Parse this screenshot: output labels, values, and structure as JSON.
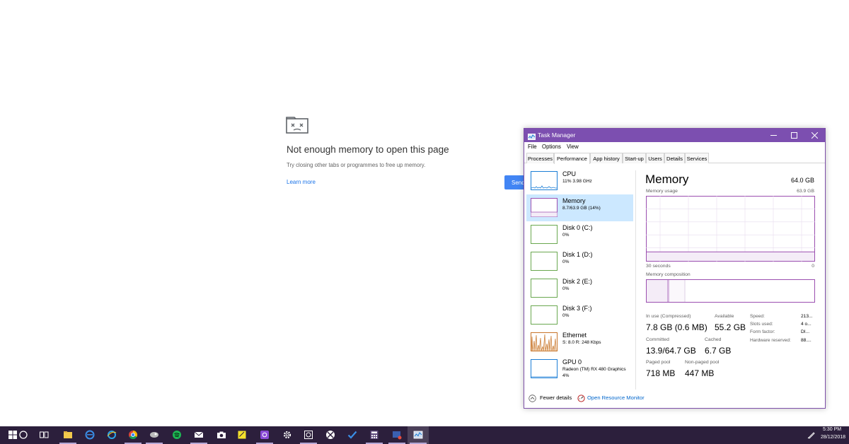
{
  "chrome_error": {
    "title": "Not enough memory to open this page",
    "subtitle": "Try closing other tabs or programmes to free up memory.",
    "link": "Learn more",
    "send_button": "Send"
  },
  "task_manager": {
    "title": "Task Manager",
    "accent_color": "#7c4fb0",
    "menu": [
      "File",
      "Options",
      "View"
    ],
    "tabs": [
      "Processes",
      "Performance",
      "App history",
      "Start-up",
      "Users",
      "Details",
      "Services"
    ],
    "active_tab": "Performance",
    "resources": [
      {
        "name": "CPU",
        "sub": "11%  3.98 GHz",
        "sub2": "",
        "color": "#1c7ed6"
      },
      {
        "name": "Memory",
        "sub": "8.7/63.9 GB (14%)",
        "sub2": "",
        "color": "#9b4fb0",
        "selected": true
      },
      {
        "name": "Disk 0 (C:)",
        "sub": "0%",
        "sub2": "",
        "color": "#6aa84f"
      },
      {
        "name": "Disk 1 (D:)",
        "sub": "0%",
        "sub2": "",
        "color": "#6aa84f"
      },
      {
        "name": "Disk 2 (E:)",
        "sub": "0%",
        "sub2": "",
        "color": "#6aa84f"
      },
      {
        "name": "Disk 3 (F:)",
        "sub": "0%",
        "sub2": "",
        "color": "#6aa84f"
      },
      {
        "name": "Ethernet",
        "sub": "S: 8.0  R: 248 Kbps",
        "sub2": "",
        "color": "#c8752a"
      },
      {
        "name": "GPU 0",
        "sub": "Radeon (TM) RX 480 Graphics",
        "sub2": "4%",
        "color": "#1c7ed6"
      }
    ],
    "memory": {
      "heading": "Memory",
      "total": "64.0 GB",
      "usage_label": "Memory usage",
      "usage_max": "63.9 GB",
      "usage_fraction": 0.14,
      "time_left": "30 seconds",
      "time_right": "0",
      "composition_label": "Memory composition",
      "in_use_label": "In use (Compressed)",
      "in_use_value": "7.8 GB (0.6 MB)",
      "available_label": "Available",
      "available_value": "55.2 GB",
      "committed_label": "Committed",
      "committed_value": "13.9/64.7 GB",
      "cached_label": "Cached",
      "cached_value": "6.7 GB",
      "paged_label": "Paged pool",
      "paged_value": "718 MB",
      "nonpaged_label": "Non-paged pool",
      "nonpaged_value": "447 MB",
      "speed_label": "Speed:",
      "speed_value": "213...",
      "slots_label": "Slots used:",
      "slots_value": "4 o...",
      "form_label": "Form factor:",
      "form_value": "DI...",
      "hw_label": "Hardware reserved:",
      "hw_value": "88...."
    },
    "footer": {
      "fewer_details": "Fewer details",
      "resource_monitor": "Open Resource Monitor"
    }
  },
  "taskbar": {
    "color": "#2c1f3c",
    "icons": [
      "windows-start-icon",
      "cortana-icon",
      "task-view-icon",
      "file-explorer-icon",
      "edge-icon",
      "internet-explorer-icon",
      "chrome-icon",
      "app-icon",
      "spotify-icon",
      "mail-icon",
      "camera-icon",
      "sticky-notes-icon",
      "instagram-icon",
      "settings-icon",
      "photo-viewer-icon",
      "xbox-icon",
      "todo-icon",
      "calculator-icon",
      "snip-icon",
      "task-manager-icon"
    ],
    "time": "5:30 PM",
    "date": "28/12/2018"
  }
}
